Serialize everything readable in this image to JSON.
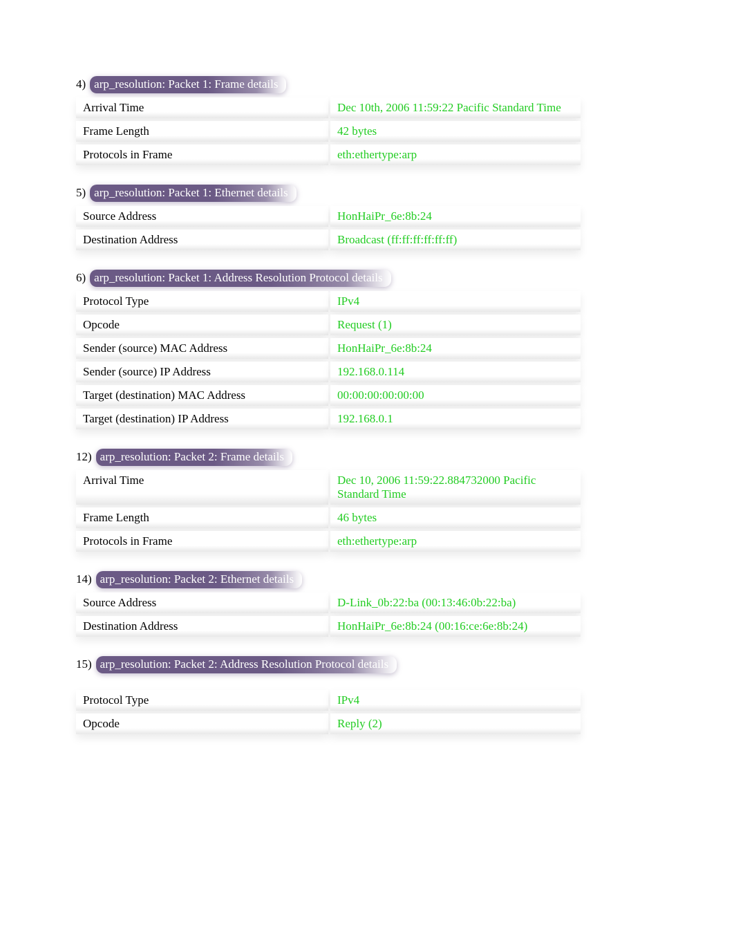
{
  "sections": [
    {
      "number": "4)",
      "title": "arp_resolution: Packet 1: Frame details",
      "rows": [
        {
          "label": "Arrival Time",
          "value": "Dec 10th, 2006 11:59:22 Pacific Standard Time"
        },
        {
          "label": "Frame Length",
          "value": "42 bytes"
        },
        {
          "label": "Protocols in Frame",
          "value": "eth:ethertype:arp"
        }
      ]
    },
    {
      "number": "5)",
      "title": "arp_resolution: Packet 1: Ethernet details",
      "rows": [
        {
          "label": "Source Address",
          "value": "HonHaiPr_6e:8b:24"
        },
        {
          "label": "Destination Address",
          "value": "Broadcast (ff:ff:ff:ff:ff:ff)"
        }
      ]
    },
    {
      "number": "6)",
      "title": "arp_resolution: Packet 1: Address Resolution Protocol details",
      "rows": [
        {
          "label": "Protocol Type",
          "value": "IPv4"
        },
        {
          "label": "Opcode",
          "value": "Request (1)"
        },
        {
          "label": "Sender (source) MAC Address",
          "value": "HonHaiPr_6e:8b:24"
        },
        {
          "label": "Sender (source) IP Address",
          "value": "192.168.0.114"
        },
        {
          "label": "Target (destination) MAC Address",
          "value": "00:00:00:00:00:00"
        },
        {
          "label": "Target (destination) IP Address",
          "value": "192.168.0.1"
        }
      ]
    },
    {
      "number": "12)",
      "title": "arp_resolution: Packet 2: Frame details",
      "rows": [
        {
          "label": "Arrival Time",
          "value": "Dec 10, 2006 11:59:22.884732000 Pacific Standard Time"
        },
        {
          "label": "Frame Length",
          "value": "46 bytes"
        },
        {
          "label": "Protocols in Frame",
          "value": "eth:ethertype:arp"
        }
      ]
    },
    {
      "number": "14)",
      "title": "arp_resolution: Packet 2: Ethernet details",
      "rows": [
        {
          "label": "Source Address",
          "value": "D-Link_0b:22:ba (00:13:46:0b:22:ba)"
        },
        {
          "label": "Destination Address",
          "value": "HonHaiPr_6e:8b:24 (00:16:ce:6e:8b:24)"
        }
      ]
    },
    {
      "number": "15)",
      "title": "arp_resolution: Packet 2: Address Resolution Protocol details",
      "spacerBefore": true,
      "rows": [
        {
          "label": "Protocol Type",
          "value": "IPv4"
        },
        {
          "label": "Opcode",
          "value": "Reply (2)"
        }
      ]
    }
  ]
}
